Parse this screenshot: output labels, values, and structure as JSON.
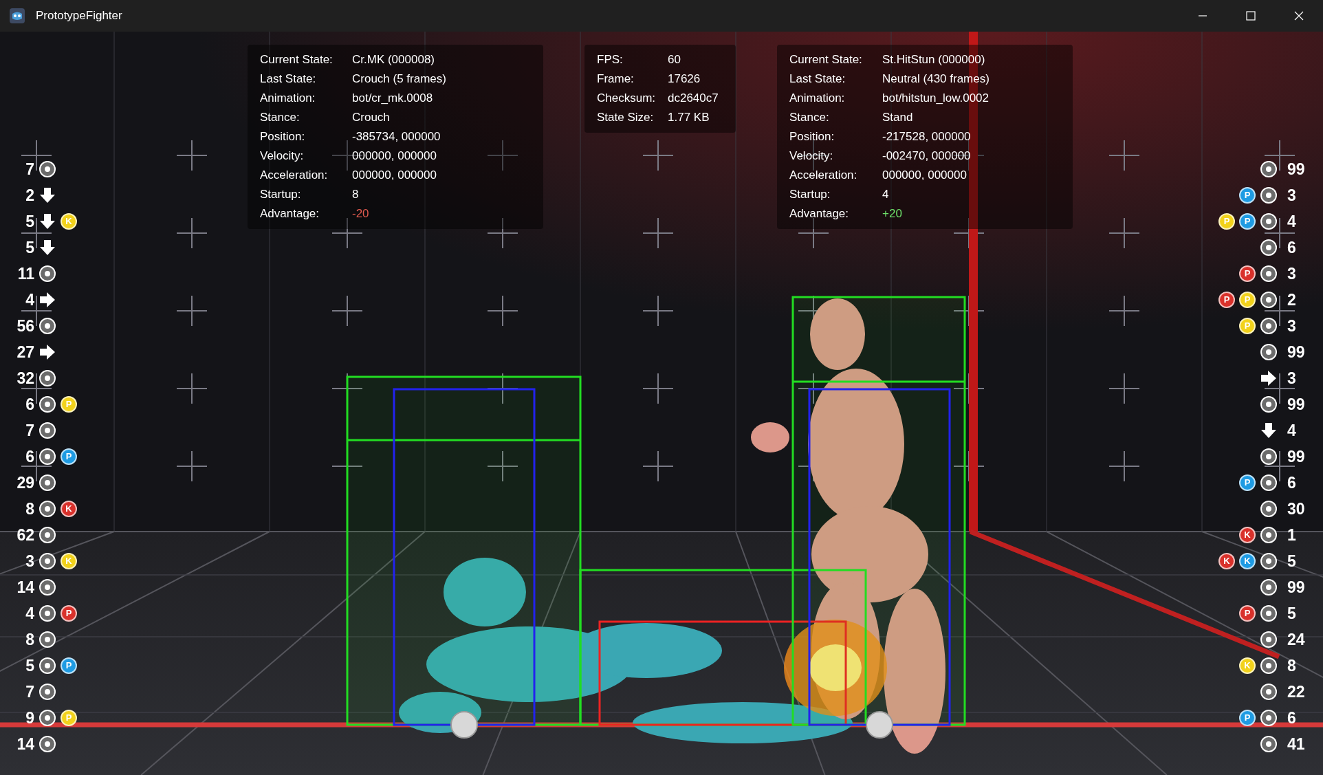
{
  "window": {
    "title": "PrototypeFighter"
  },
  "player_1_stats": [
    {
      "label": "Current State:",
      "value": "Cr.MK (000008)",
      "color": "#ffffff"
    },
    {
      "label": "Last State:",
      "value": "Crouch (5 frames)",
      "color": "#ffffff"
    },
    {
      "label": "Animation:",
      "value": "bot/cr_mk.0008",
      "color": "#ffffff"
    },
    {
      "label": "Stance:",
      "value": "Crouch",
      "color": "#ffffff"
    },
    {
      "label": "Position:",
      "value": "-385734, 000000",
      "color": "#ffffff"
    },
    {
      "label": "Velocity:",
      "value": "000000, 000000",
      "color": "#ffffff"
    },
    {
      "label": "Acceleration:",
      "value": "000000, 000000",
      "color": "#ffffff"
    },
    {
      "label": "Startup:",
      "value": "8",
      "color": "#ffffff"
    },
    {
      "label": "Advantage:",
      "value": "-20",
      "color": "#e05a4f"
    }
  ],
  "game_stats": [
    {
      "label": "FPS:",
      "value": "60"
    },
    {
      "label": "Frame:",
      "value": "17626"
    },
    {
      "label": "Checksum:",
      "value": "dc2640c7"
    },
    {
      "label": "State Size:",
      "value": "1.77 KB"
    }
  ],
  "player_2_stats": [
    {
      "label": "Current State:",
      "value": "St.HitStun (000000)",
      "color": "#ffffff"
    },
    {
      "label": "Last State:",
      "value": "Neutral (430 frames)",
      "color": "#ffffff"
    },
    {
      "label": "Animation:",
      "value": "bot/hitstun_low.0002",
      "color": "#ffffff"
    },
    {
      "label": "Stance:",
      "value": "Stand",
      "color": "#ffffff"
    },
    {
      "label": "Position:",
      "value": "-217528, 000000",
      "color": "#ffffff"
    },
    {
      "label": "Velocity:",
      "value": "-002470, 000000",
      "color": "#ffffff"
    },
    {
      "label": "Acceleration:",
      "value": "000000, 000000",
      "color": "#ffffff"
    },
    {
      "label": "Startup:",
      "value": "4",
      "color": "#ffffff"
    },
    {
      "label": "Advantage:",
      "value": "+20",
      "color": "#6ee06a"
    }
  ],
  "player_1_inputs": [
    {
      "frames": "7",
      "kind": "neutral"
    },
    {
      "frames": "2",
      "kind": "down"
    },
    {
      "frames": "5",
      "kind": "down",
      "buttons": [
        {
          "label": "K",
          "color": "#f2d21b"
        }
      ]
    },
    {
      "frames": "5",
      "kind": "down"
    },
    {
      "frames": "11",
      "kind": "neutral"
    },
    {
      "frames": "4",
      "kind": "right"
    },
    {
      "frames": "56",
      "kind": "neutral"
    },
    {
      "frames": "27",
      "kind": "right"
    },
    {
      "frames": "32",
      "kind": "neutral"
    },
    {
      "frames": "6",
      "kind": "neutral",
      "buttons": [
        {
          "label": "P",
          "color": "#f2d21b"
        }
      ]
    },
    {
      "frames": "7",
      "kind": "neutral"
    },
    {
      "frames": "6",
      "kind": "neutral",
      "buttons": [
        {
          "label": "P",
          "color": "#1e9be3"
        }
      ]
    },
    {
      "frames": "29",
      "kind": "neutral"
    },
    {
      "frames": "8",
      "kind": "neutral",
      "buttons": [
        {
          "label": "K",
          "color": "#d9312b"
        }
      ]
    },
    {
      "frames": "62",
      "kind": "neutral"
    },
    {
      "frames": "3",
      "kind": "neutral",
      "buttons": [
        {
          "label": "K",
          "color": "#f2d21b"
        }
      ]
    },
    {
      "frames": "14",
      "kind": "neutral"
    },
    {
      "frames": "4",
      "kind": "neutral",
      "buttons": [
        {
          "label": "P",
          "color": "#d9312b"
        }
      ]
    },
    {
      "frames": "8",
      "kind": "neutral"
    },
    {
      "frames": "5",
      "kind": "neutral",
      "buttons": [
        {
          "label": "P",
          "color": "#1e9be3"
        }
      ]
    },
    {
      "frames": "7",
      "kind": "neutral"
    },
    {
      "frames": "9",
      "kind": "neutral",
      "buttons": [
        {
          "label": "P",
          "color": "#f2d21b"
        }
      ]
    },
    {
      "frames": "14",
      "kind": "neutral"
    }
  ],
  "player_2_inputs": [
    {
      "frames": "99",
      "kind": "neutral"
    },
    {
      "frames": "3",
      "kind": "neutral",
      "buttons": [
        {
          "label": "P",
          "color": "#1e9be3"
        }
      ]
    },
    {
      "frames": "4",
      "kind": "neutral",
      "buttons": [
        {
          "label": "P",
          "color": "#f2d21b"
        },
        {
          "label": "P",
          "color": "#1e9be3"
        }
      ]
    },
    {
      "frames": "6",
      "kind": "neutral"
    },
    {
      "frames": "3",
      "kind": "neutral",
      "buttons": [
        {
          "label": "P",
          "color": "#d9312b"
        }
      ]
    },
    {
      "frames": "2",
      "kind": "neutral",
      "buttons": [
        {
          "label": "P",
          "color": "#d9312b"
        },
        {
          "label": "P",
          "color": "#f2d21b"
        }
      ]
    },
    {
      "frames": "3",
      "kind": "neutral",
      "buttons": [
        {
          "label": "P",
          "color": "#f2d21b"
        }
      ]
    },
    {
      "frames": "99",
      "kind": "neutral"
    },
    {
      "frames": "3",
      "kind": "right"
    },
    {
      "frames": "99",
      "kind": "neutral"
    },
    {
      "frames": "4",
      "kind": "down"
    },
    {
      "frames": "99",
      "kind": "neutral"
    },
    {
      "frames": "6",
      "kind": "neutral",
      "buttons": [
        {
          "label": "P",
          "color": "#1e9be3"
        }
      ]
    },
    {
      "frames": "30",
      "kind": "neutral"
    },
    {
      "frames": "1",
      "kind": "neutral",
      "buttons": [
        {
          "label": "K",
          "color": "#d9312b"
        }
      ]
    },
    {
      "frames": "5",
      "kind": "neutral",
      "buttons": [
        {
          "label": "K",
          "color": "#d9312b"
        },
        {
          "label": "K",
          "color": "#1e9be3"
        }
      ]
    },
    {
      "frames": "99",
      "kind": "neutral"
    },
    {
      "frames": "5",
      "kind": "neutral",
      "buttons": [
        {
          "label": "P",
          "color": "#d9312b"
        }
      ]
    },
    {
      "frames": "24",
      "kind": "neutral"
    },
    {
      "frames": "8",
      "kind": "neutral",
      "buttons": [
        {
          "label": "K",
          "color": "#f2d21b"
        }
      ]
    },
    {
      "frames": "22",
      "kind": "neutral"
    },
    {
      "frames": "6",
      "kind": "neutral",
      "buttons": [
        {
          "label": "P",
          "color": "#1e9be3"
        }
      ]
    },
    {
      "frames": "41",
      "kind": "neutral"
    }
  ]
}
